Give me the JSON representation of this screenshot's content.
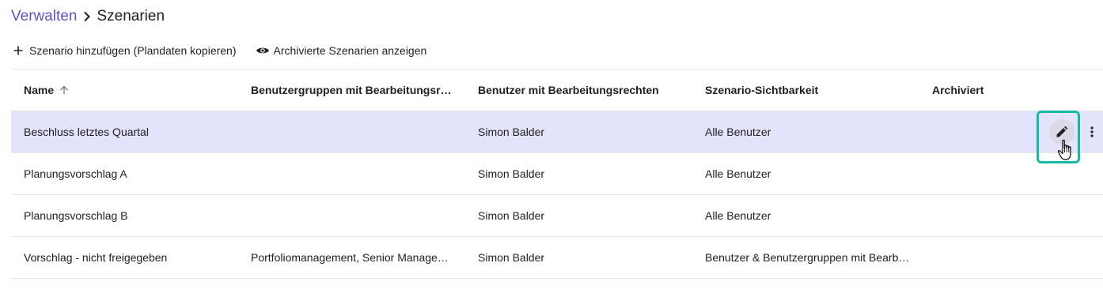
{
  "breadcrumb": {
    "parent": "Verwalten",
    "current": "Szenarien"
  },
  "toolbar": {
    "add_label": "Szenario hinzufügen (Plandaten kopieren)",
    "show_archived_label": "Archivierte Szenarien anzeigen"
  },
  "table": {
    "columns": [
      "Name",
      "Benutzergruppen mit Bearbeitungsr…",
      "Benutzer mit Bearbeitungsrechten",
      "Szenario-Sichtbarkeit",
      "Archiviert"
    ],
    "sort": {
      "column": "Name",
      "direction": "ascending"
    },
    "rows": [
      [
        "Beschluss letztes Quartal",
        "",
        "Simon Balder",
        "Alle Benutzer",
        ""
      ],
      [
        "Planungsvorschlag A",
        "",
        "Simon Balder",
        "Alle Benutzer",
        ""
      ],
      [
        "Planungsvorschlag B",
        "",
        "Simon Balder",
        "Alle Benutzer",
        ""
      ],
      [
        "Vorschlag - nicht freigegeben",
        "Portfoliomanagement, Senior Manage…",
        "Simon Balder",
        "Benutzer & Benutzergruppen mit Bearb…",
        ""
      ]
    ],
    "selected_row": 0
  },
  "icons": {
    "add": "plus-icon",
    "show_archived": "eye-icon",
    "sort": "arrow-up-icon",
    "edit": "pencil-icon",
    "more": "more-vertical-icon",
    "cursor": "hand-pointer-icon"
  },
  "colors": {
    "link": "#5c55c7",
    "selected_row": "#e3e3fb",
    "highlight": "#17b9a5"
  }
}
